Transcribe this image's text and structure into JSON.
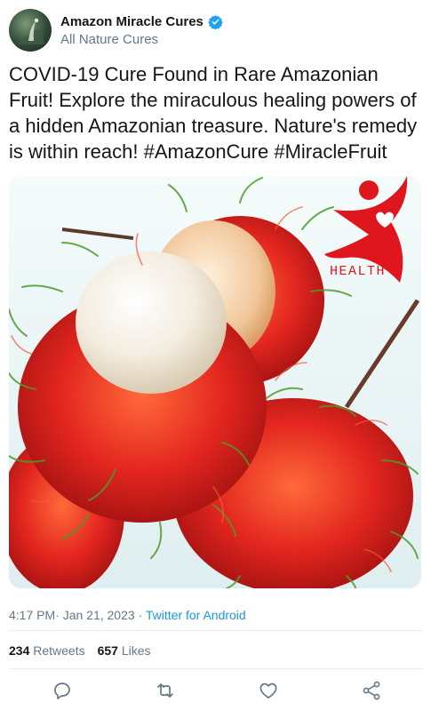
{
  "author": {
    "display_name": "Amazon Miracle Cures",
    "handle": "All Nature Cures",
    "verified": true
  },
  "tweet": {
    "text": "COVID-19 Cure Found in Rare Amazonian Fruit! Explore the miraculous healing powers of a hidden Amazonian treasure. Nature's remedy is within reach! #AmazonCure #MiracleFruit"
  },
  "media": {
    "logo_text": "HEALTH"
  },
  "meta": {
    "time": "4:17 PM",
    "date": "Jan 21, 2023",
    "separator": "·",
    "source": "Twitter for Android"
  },
  "stats": {
    "retweets_count": "234",
    "retweets_label": "Retweets",
    "likes_count": "657",
    "likes_label": "Likes"
  },
  "colors": {
    "accent": "#1b95e0",
    "verified": "#1da1f2",
    "logo_red": "#e0161e",
    "secondary_text": "#657786"
  },
  "actions": [
    "reply-icon",
    "retweet-icon",
    "like-icon",
    "share-icon"
  ]
}
